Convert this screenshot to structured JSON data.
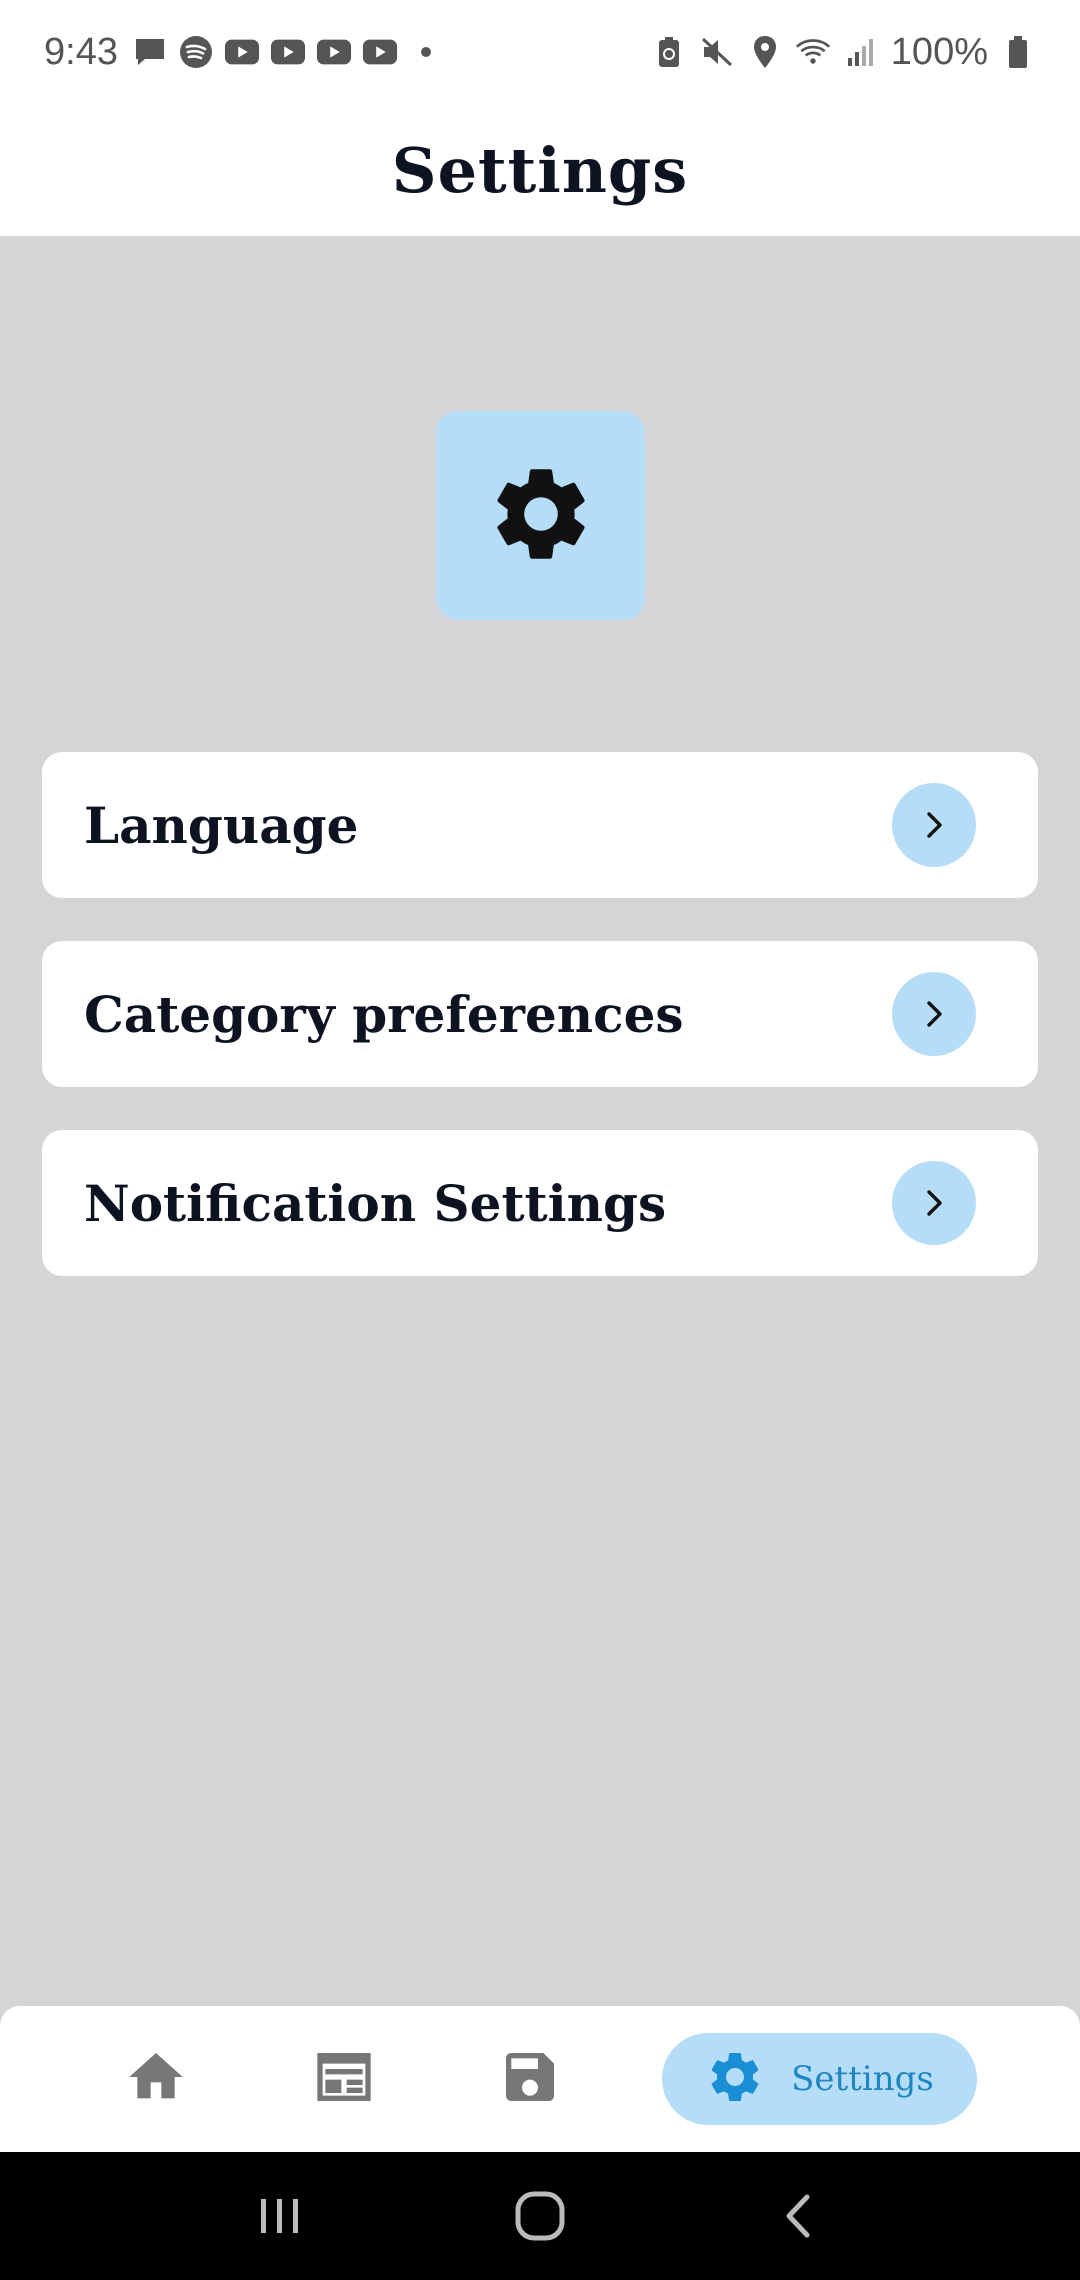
{
  "status_bar": {
    "time": "9:43",
    "battery_percent": "100%",
    "left_icons": [
      "message-icon",
      "spotify-icon",
      "youtube-icon",
      "youtube-icon",
      "youtube-icon",
      "youtube-icon",
      "dot-icon"
    ],
    "right_icons": [
      "battery-saver-icon",
      "mute-icon",
      "location-icon",
      "wifi-icon",
      "signal-icon",
      "battery-icon"
    ]
  },
  "header": {
    "title": "Settings"
  },
  "hero": {
    "icon": "gear-icon"
  },
  "settings_list": {
    "items": [
      {
        "label": "Language",
        "icon": "chevron-right-icon"
      },
      {
        "label": "Category preferences",
        "icon": "chevron-right-icon"
      },
      {
        "label": "Notification Settings",
        "icon": "chevron-right-icon"
      }
    ]
  },
  "bottom_nav": {
    "items": [
      {
        "icon": "home-icon",
        "active": false
      },
      {
        "icon": "newspaper-icon",
        "active": false
      },
      {
        "icon": "save-icon",
        "active": false
      },
      {
        "icon": "gear-icon",
        "label": "Settings",
        "active": true
      }
    ]
  },
  "system_nav": {
    "buttons": [
      "recents-icon",
      "home-circle-icon",
      "back-icon"
    ]
  },
  "colors": {
    "background": "#d5d4d6",
    "accent_light": "#b5ddf8",
    "accent_text": "#1f86c2",
    "title_text": "#0d1321"
  }
}
